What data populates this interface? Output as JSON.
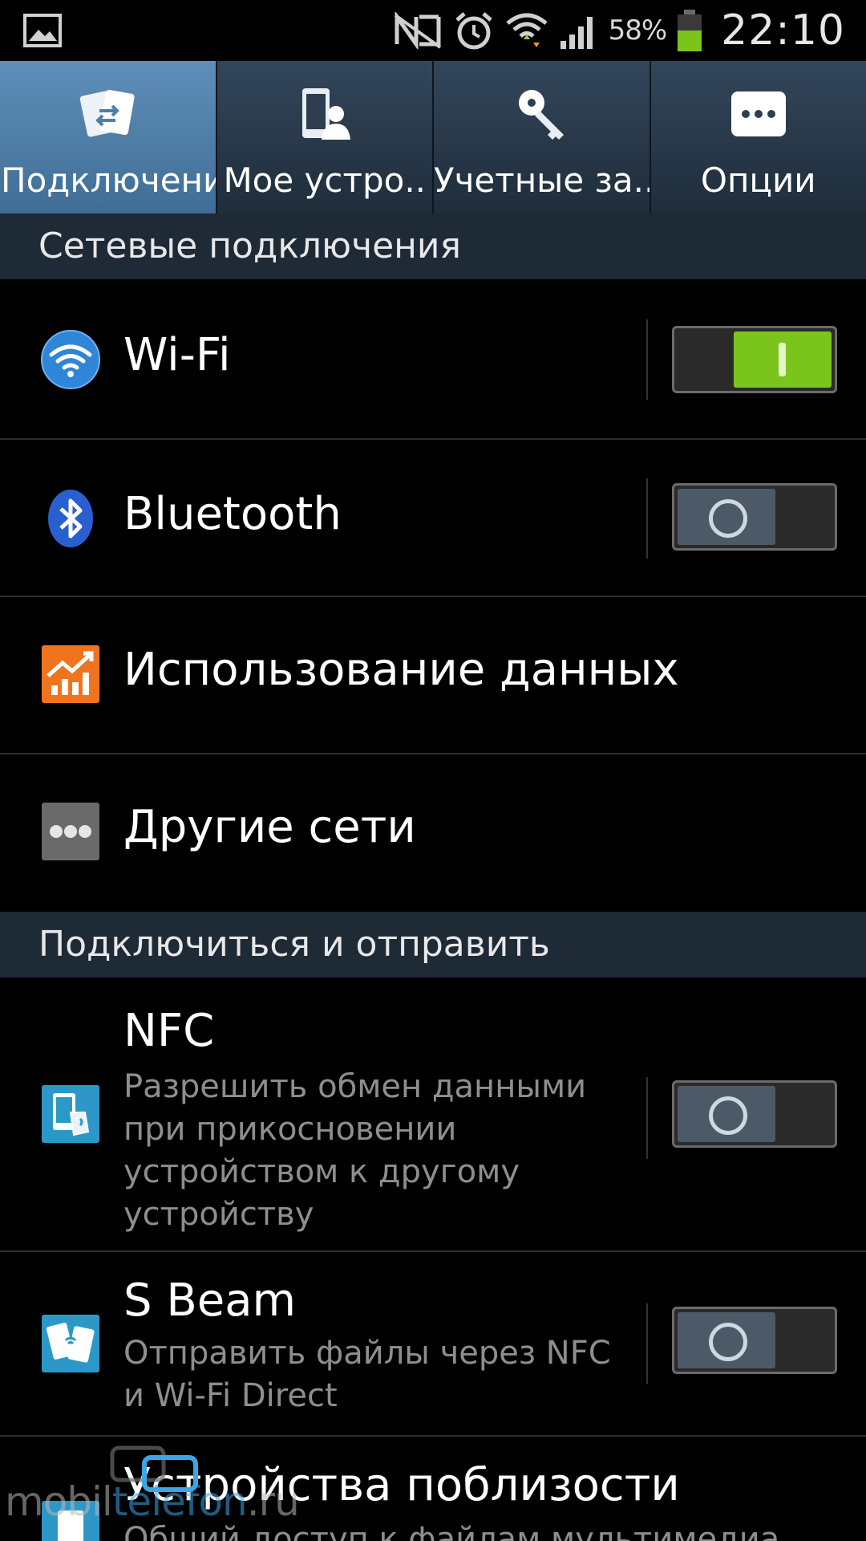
{
  "status_bar": {
    "battery_percent": "58%",
    "time": "22:10",
    "icons": [
      "gallery-icon",
      "nfc-muted-icon",
      "alarm-icon",
      "wifi-icon",
      "signal-icon",
      "battery-icon"
    ]
  },
  "tabs": [
    {
      "label": "Подключени",
      "icon": "connections-icon",
      "active": true
    },
    {
      "label": "Мое устро..",
      "icon": "my-device-icon",
      "active": false
    },
    {
      "label": "Учетные за..",
      "icon": "accounts-key-icon",
      "active": false
    },
    {
      "label": "Опции",
      "icon": "more-options-icon",
      "active": false
    }
  ],
  "sections": [
    {
      "title": "Сетевые подключения"
    },
    {
      "title": "Подключиться и отправить"
    }
  ],
  "rows": {
    "wifi": {
      "title": "Wi-Fi",
      "icon": "wifi-icon",
      "toggle": "on"
    },
    "bluetooth": {
      "title": "Bluetooth",
      "icon": "bluetooth-icon",
      "toggle": "off"
    },
    "data_usage": {
      "title": "Использование данных",
      "icon": "data-usage-icon"
    },
    "other_networks": {
      "title": "Другие сети",
      "icon": "more-networks-icon"
    },
    "nfc": {
      "title": "NFC",
      "description": "Разрешить обмен данными при прикосновении устройством к другому устройству",
      "icon": "nfc-icon",
      "toggle": "off"
    },
    "sbeam": {
      "title": "S Beam",
      "description": "Отправить файлы через NFC и Wi-Fi Direct",
      "icon": "sbeam-icon",
      "toggle": "off"
    },
    "nearby": {
      "title": "Устройства поблизости",
      "description": "Общий доступ к файлам мультимедиа",
      "icon": "nearby-devices-icon"
    }
  },
  "watermark": {
    "prefix": "mobil",
    "highlight": "telefon",
    "suffix": ".ru"
  },
  "colors": {
    "toggle_on": "#7ac41c",
    "toggle_off_knob": "#4c5a68",
    "active_tab": "#4f7ea8",
    "section_bg": "#1e2a36",
    "data_usage_orange": "#f0731e"
  }
}
